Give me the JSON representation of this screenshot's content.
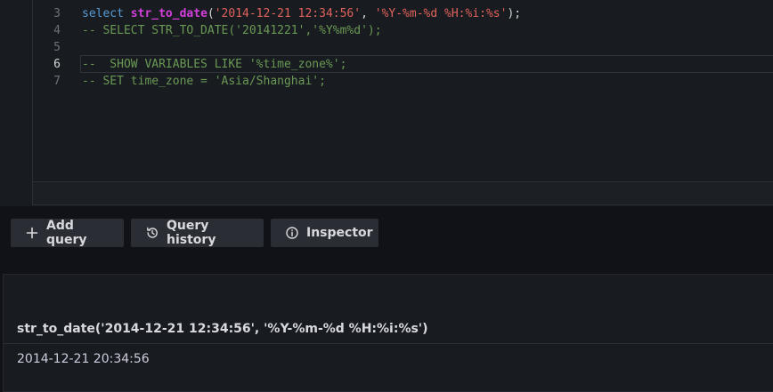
{
  "editor": {
    "line_numbers": [
      "3",
      "4",
      "5",
      "6",
      "7"
    ],
    "lines": {
      "l3": {
        "kw": "select",
        "fn": "str_to_date",
        "open": "(",
        "arg1": "'2014-12-21 12:34:56'",
        "comma": ", ",
        "arg2": "'%Y-%m-%d %H:%i:%s'",
        "close": ");"
      },
      "l4": "-- SELECT STR_TO_DATE('20141221','%Y%m%d');",
      "l5": "",
      "l6": "--  SHOW VARIABLES LIKE '%time_zone%';",
      "l7": "-- SET time_zone = 'Asia/Shanghai';"
    }
  },
  "toolbar": {
    "add_query_label": "Add query",
    "query_history_label": "Query history",
    "inspector_label": "Inspector"
  },
  "result": {
    "column_header": "str_to_date('2014-12-21 12:34:56', '%Y-%m-%d %H:%i:%s')",
    "rows": [
      "2014-12-21 20:34:56"
    ]
  }
}
